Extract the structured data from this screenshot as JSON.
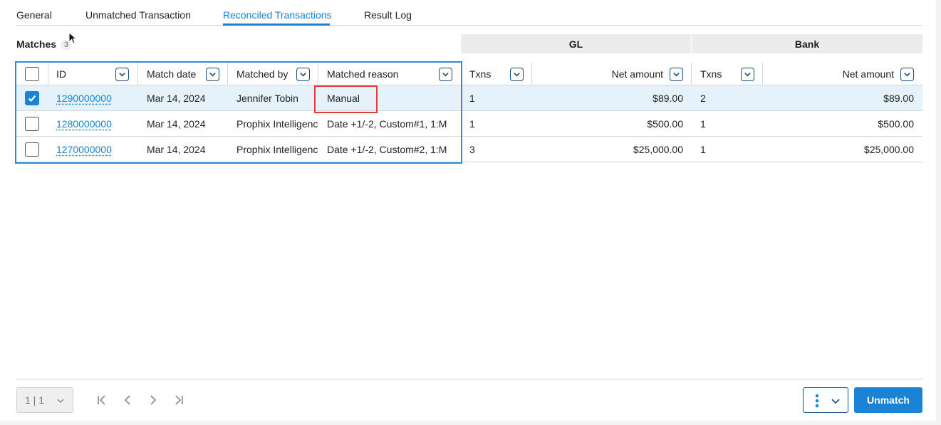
{
  "tabs": [
    {
      "label": "General"
    },
    {
      "label": "Unmatched Transaction"
    },
    {
      "label": "Reconciled Transactions",
      "active": true
    },
    {
      "label": "Result Log"
    }
  ],
  "matches": {
    "label": "Matches",
    "count": "3"
  },
  "groups": {
    "gl": "GL",
    "bank": "Bank"
  },
  "columns": {
    "id": "ID",
    "match_date": "Match date",
    "matched_by": "Matched by",
    "matched_reason": "Matched reason",
    "gl_txns": "Txns",
    "gl_net": "Net amount",
    "bank_txns": "Txns",
    "bank_net": "Net amount"
  },
  "rows": [
    {
      "checked": true,
      "id": "1290000000",
      "match_date": "Mar 14, 2024",
      "matched_by": "Jennifer Tobin",
      "matched_reason": "Manual",
      "gl_txns": "1",
      "gl_net": "$89.00",
      "bank_txns": "2",
      "bank_net": "$89.00"
    },
    {
      "checked": false,
      "id": "1280000000",
      "match_date": "Mar 14, 2024",
      "matched_by": "Prophix Intelligence",
      "matched_reason": "Date +1/-2, Custom#1, 1:M",
      "gl_txns": "1",
      "gl_net": "$500.00",
      "bank_txns": "1",
      "bank_net": "$500.00"
    },
    {
      "checked": false,
      "id": "1270000000",
      "match_date": "Mar 14, 2024",
      "matched_by": "Prophix Intelligence",
      "matched_reason": "Date +1/-2, Custom#2, 1:M",
      "gl_txns": "3",
      "gl_net": "$25,000.00",
      "bank_txns": "1",
      "bank_net": "$25,000.00"
    }
  ],
  "footer": {
    "page_select": "1 | 1",
    "unmatch_label": "Unmatch"
  },
  "colors": {
    "accent": "#1a83d6",
    "selected_row": "#e6f2fb",
    "highlight": "#e03c3c"
  }
}
